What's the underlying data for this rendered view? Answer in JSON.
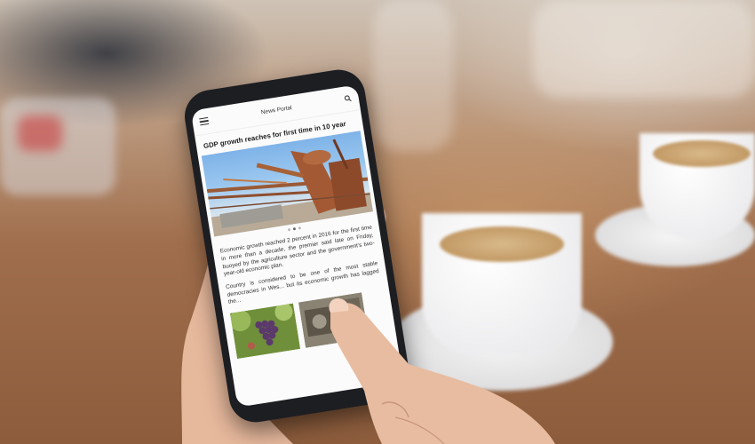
{
  "app": {
    "title": "News Portal",
    "menu_icon": "hamburger-menu-icon",
    "search_icon": "search-icon"
  },
  "article": {
    "headline": "GDP growth reaches for first time in 10 year",
    "hero_image": "industrial-rusty-pipes-photo",
    "carousel_dots": 3,
    "carousel_active": 1,
    "paragraph1": "Economic growth reached 2 percent in 2016 for the first time in more than a decade, the premier said late on Friday, buoyed by the agriculture sector and the government's two-year-old economic plan.",
    "paragraph2": "Country is considered to be one of the most stable democracies in Wes... but its economic growth has lagged the..."
  },
  "thumbnails": [
    {
      "name": "grapes-vineyard-photo"
    },
    {
      "name": "machinery-photo"
    }
  ]
}
